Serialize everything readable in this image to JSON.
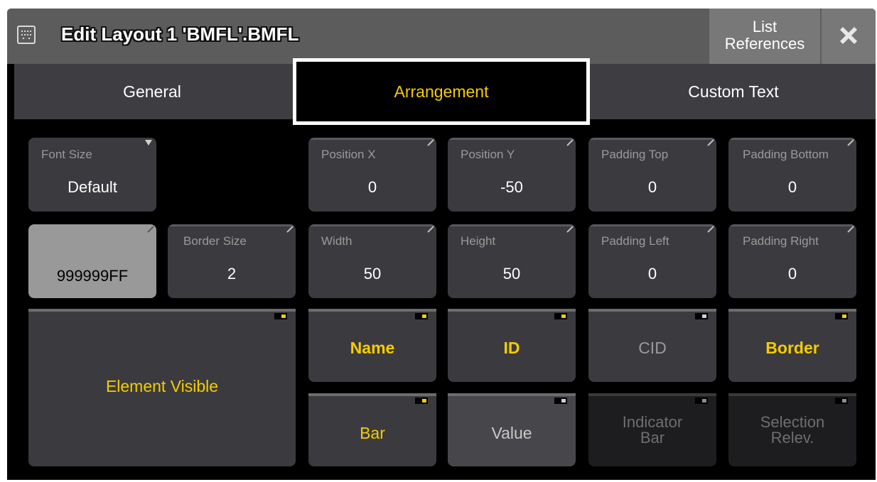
{
  "window": {
    "title": "Edit Layout 1 'BMFL'.BMFL",
    "list_references_line1": "List",
    "list_references_line2": "References"
  },
  "tabs": [
    {
      "label": "General",
      "active": false
    },
    {
      "label": "Arrangement",
      "active": true
    },
    {
      "label": "Custom Text",
      "active": false
    }
  ],
  "fields": {
    "font_size": {
      "label": "Font Size",
      "value": "Default"
    },
    "position_x": {
      "label": "Position X",
      "value": "0"
    },
    "position_y": {
      "label": "Position Y",
      "value": "-50"
    },
    "padding_top": {
      "label": "Padding Top",
      "value": "0"
    },
    "padding_bottom": {
      "label": "Padding Bottom",
      "value": "0"
    },
    "border_color": {
      "value": "999999FF"
    },
    "border_size": {
      "label": "Border Size",
      "value": "2"
    },
    "width": {
      "label": "Width",
      "value": "50"
    },
    "height": {
      "label": "Height",
      "value": "50"
    },
    "padding_left": {
      "label": "Padding Left",
      "value": "0"
    },
    "padding_right": {
      "label": "Padding Right",
      "value": "0"
    }
  },
  "toggles": {
    "element_visible": {
      "label": "Element Visible",
      "state": "on"
    },
    "name": {
      "label": "Name",
      "state": "on"
    },
    "id": {
      "label": "ID",
      "state": "on"
    },
    "cid": {
      "label": "CID",
      "state": "off"
    },
    "border": {
      "label": "Border",
      "state": "on"
    },
    "bar": {
      "label": "Bar",
      "state": "on"
    },
    "value": {
      "label": "Value",
      "state": "off"
    },
    "indicator_bar": {
      "label_line1": "Indicator",
      "label_line2": "Bar",
      "state": "disabled"
    },
    "selection_relev": {
      "label_line1": "Selection",
      "label_line2": "Relev.",
      "state": "disabled"
    }
  },
  "colors": {
    "accent": "#f5cc00",
    "border_swatch": "#999999"
  }
}
